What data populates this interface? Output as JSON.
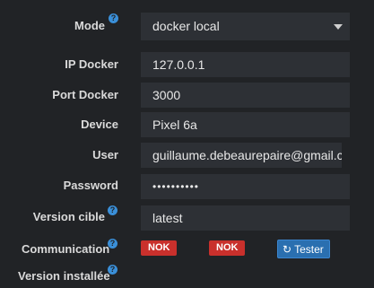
{
  "form": {
    "mode": {
      "label": "Mode",
      "value": "docker local"
    },
    "ip": {
      "label": "IP Docker",
      "value": "127.0.0.1"
    },
    "port": {
      "label": "Port Docker",
      "value": "3000"
    },
    "device": {
      "label": "Device",
      "value": "Pixel 6a"
    },
    "user": {
      "label": "User",
      "value": "guillaume.debeaurepaire@gmail.com"
    },
    "password": {
      "label": "Password",
      "value": "••••••••••"
    },
    "version_cible": {
      "label": "Version cible",
      "value": "latest"
    },
    "communication": {
      "label": "Communication",
      "status1": "NOK",
      "status2": "NOK",
      "tester_label": "Tester"
    },
    "version_installee": {
      "label": "Version installée"
    }
  },
  "icons": {
    "help": "question-circle-icon",
    "refresh": "refresh-icon",
    "caret": "chevron-down-icon"
  },
  "colors": {
    "background": "#212326",
    "field": "#2d3035",
    "danger": "#c9302c",
    "primary": "#2a6fb0",
    "help": "#3a8fd8"
  }
}
